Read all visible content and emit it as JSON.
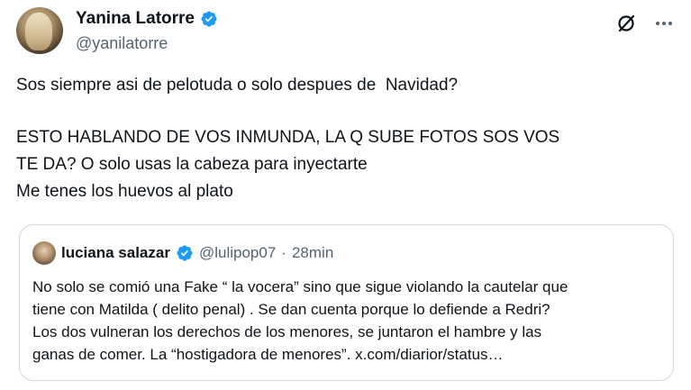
{
  "author": {
    "display_name": "Yanina Latorre",
    "handle": "@yanilatorre"
  },
  "icons": {
    "verified": "verified-badge-icon",
    "grok": "grok-icon",
    "more": "more-icon",
    "accent": "#1d9bf0"
  },
  "tweet": {
    "lines": [
      "Sos siempre asi de pelotuda o solo despues de  Navidad?",
      "ESTO HABLANDO DE VOS INMUNDA, LA Q SUBE FOTOS SOS VOS",
      "TE DA? O solo usas la cabeza para inyectarte",
      "Me tenes los huevos al plato"
    ]
  },
  "quote": {
    "display_name": "luciana salazar",
    "handle": "@lulipop07",
    "separator": "·",
    "time": "28min",
    "lines": [
      "No solo se comió una Fake “ la vocera” sino que sigue violando la cautelar que",
      "tiene con Matilda ( delito penal) . Se dan cuenta porque lo defiende a Redri?",
      "Los dos vulneran los derechos de los menores, se juntaron el hambre y las",
      "ganas de comer. La “hostigadora de menores”. x.com/diarior/status…"
    ]
  }
}
